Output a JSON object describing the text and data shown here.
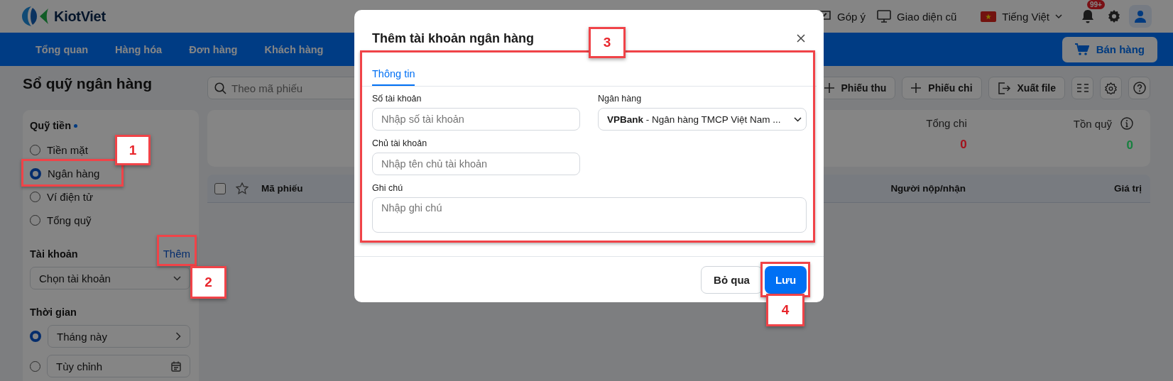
{
  "topbar": {
    "logo": "KiotViet",
    "links": [
      {
        "label": "Góp ý"
      },
      {
        "label": "Giao diện cũ"
      }
    ],
    "language": "Tiếng Việt",
    "notification_badge": "99+"
  },
  "nav": {
    "items": [
      "Tổng quan",
      "Hàng hóa",
      "Đơn hàng",
      "Khách hàng"
    ],
    "sell_button": "Bán hàng"
  },
  "page": {
    "title": "Sổ quỹ ngân hàng",
    "search": {
      "placeholder": "Theo mã phiếu"
    },
    "actions": [
      {
        "label": "Phiếu thu"
      },
      {
        "label": "Phiếu chi"
      },
      {
        "label": "Xuất file"
      }
    ]
  },
  "sidebar": {
    "fund": {
      "title": "Quỹ tiền",
      "options": [
        {
          "label": "Tiền mặt",
          "selected": false
        },
        {
          "label": "Ngân hàng",
          "selected": true
        },
        {
          "label": "Ví điện tử",
          "selected": false
        },
        {
          "label": "Tổng quỹ",
          "selected": false
        }
      ]
    },
    "account": {
      "title": "Tài khoản",
      "add_link": "Thêm",
      "select_placeholder": "Chọn tài khoản"
    },
    "time": {
      "title": "Thời gian",
      "options": [
        {
          "label": "Tháng này",
          "selected": true,
          "kind": "preset"
        },
        {
          "label": "Tùy chỉnh",
          "selected": false,
          "kind": "custom"
        }
      ]
    }
  },
  "summary": [
    {
      "label": "Tổng chi",
      "value": "0",
      "color": "#a3121c",
      "info": false
    },
    {
      "label": "Tồn quỹ",
      "value": "0",
      "color": "#17803f",
      "info": true
    }
  ],
  "table": {
    "select_all": {
      "checked": false
    },
    "columns": [
      {
        "label": "Mã phiếu"
      },
      {
        "label": "Người nộp/nhận"
      },
      {
        "label": "Giá trị"
      }
    ]
  },
  "modal": {
    "title": "Thêm tài khoản ngân hàng",
    "tabs": [
      {
        "label": "Thông tin",
        "selected": true
      }
    ],
    "fields": [
      {
        "label": "Số tài khoản",
        "kind": "input",
        "placeholder": "Nhập số tài khoản"
      },
      {
        "label": "Ngân hàng",
        "kind": "select",
        "value": "**VPBank** - Ngân hàng TMCP Việt Nam ..."
      },
      {
        "label": "Chủ tài khoản",
        "kind": "input",
        "placeholder": "Nhập tên chủ tài khoản"
      },
      {
        "label": "Ghi chú",
        "kind": "textarea",
        "placeholder": "Nhập ghi chú"
      }
    ],
    "buttons": [
      {
        "label": "Bỏ qua",
        "kind": "secondary"
      },
      {
        "label": "Lưu",
        "kind": "primary"
      }
    ]
  },
  "annotations": [
    "1",
    "2",
    "3",
    "4"
  ]
}
